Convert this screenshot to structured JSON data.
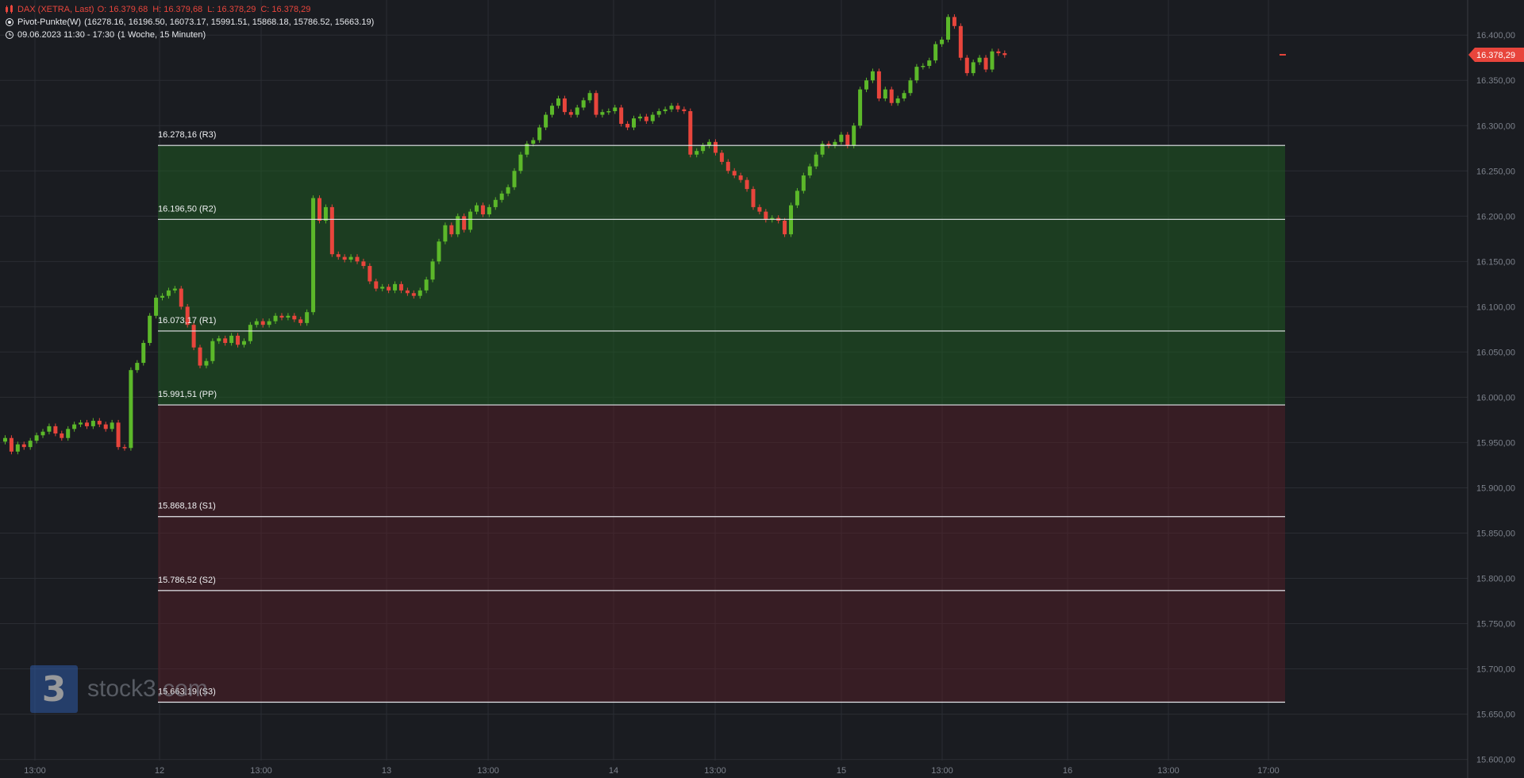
{
  "header": {
    "title": "DAX (XETRA, Last)",
    "ohlc": [
      "O: 16.379,68",
      "H: 16.379,68",
      "L: 16.378,29",
      "C: 16.378,29"
    ],
    "indicator": "Pivot-Punkte(W)",
    "indicator_values": "(16278.16,  16196.50,  16073.17,  15991.51,  15868.18,  15786.52,  15663.19)",
    "timestamp": "09.06.2023 11:30 - 17:30",
    "period": "(1 Woche, 15 Minuten)"
  },
  "colors": {
    "up": "#5cb82a",
    "down": "#e8453c",
    "background": "#1a1c21",
    "grid": "#2a2d33",
    "resistance_zone": "#1c3a1e",
    "support_zone": "#3a1c21"
  },
  "logo": {
    "text": "stock3.com"
  },
  "chart_data": {
    "type": "candlestick",
    "y_axis": {
      "side": "right",
      "range": [
        15590,
        16430
      ],
      "ticks": [
        16400,
        16350,
        16300,
        16250,
        16200,
        16150,
        16100,
        16050,
        16000,
        15950,
        15900,
        15850,
        15800,
        15750,
        15700,
        15650,
        15600
      ],
      "tick_labels": [
        "16.400,00",
        "16.350,00",
        "16.300,00",
        "16.250,00",
        "16.200,00",
        "16.150,00",
        "16.100,00",
        "16.050,00",
        "16.000,00",
        "15.950,00",
        "15.900,00",
        "15.850,00",
        "15.800,00",
        "15.750,00",
        "15.700,00",
        "15.650,00",
        "15.600,00"
      ]
    },
    "x_axis": {
      "tick_labels": [
        "13:00",
        "12",
        "13:00",
        "13",
        "13:00",
        "14",
        "13:00",
        "15",
        "13:00",
        "16",
        "13:00",
        "17:00"
      ]
    },
    "last_price": {
      "value": 16378.29,
      "label": "16.378,29"
    },
    "pivot_levels": [
      {
        "value": 16278.16,
        "label": "16.278,16 (R3)"
      },
      {
        "value": 16196.5,
        "label": "16.196,50 (R2)"
      },
      {
        "value": 16073.17,
        "label": "16.073,17 (R1)"
      },
      {
        "value": 15991.51,
        "label": "15.991,51 (PP)"
      },
      {
        "value": 15868.18,
        "label": "15.868,18 (S1)"
      },
      {
        "value": 15786.52,
        "label": "15.786,52 (S2)"
      },
      {
        "value": 15663.19,
        "label": "15.663,19 (S3)"
      }
    ],
    "grid": true,
    "closes": [
      15955,
      15940,
      15948,
      15945,
      15952,
      15958,
      15962,
      15968,
      15960,
      15955,
      15965,
      15970,
      15972,
      15968,
      15974,
      15970,
      15965,
      15972,
      15945,
      15944,
      16030,
      16038,
      16060,
      16090,
      16110,
      16112,
      16118,
      16120,
      16100,
      16080,
      16055,
      16035,
      16040,
      16062,
      16065,
      16060,
      16068,
      16058,
      16062,
      16080,
      16084,
      16080,
      16084,
      16090,
      16088,
      16090,
      16086,
      16082,
      16094,
      16220,
      16195,
      16210,
      16158,
      16155,
      16152,
      16155,
      16150,
      16145,
      16128,
      16120,
      16122,
      16118,
      16125,
      16118,
      16115,
      16112,
      16118,
      16130,
      16150,
      16172,
      16190,
      16180,
      16200,
      16185,
      16205,
      16212,
      16202,
      16210,
      16218,
      16225,
      16232,
      16250,
      16268,
      16280,
      16284,
      16298,
      16312,
      16322,
      16330,
      16315,
      16312,
      16320,
      16328,
      16336,
      16312,
      16315,
      16316,
      16320,
      16302,
      16298,
      16308,
      16310,
      16305,
      16312,
      16316,
      16318,
      16322,
      16318,
      16316,
      16268,
      16272,
      16278,
      16282,
      16270,
      16260,
      16250,
      16245,
      16240,
      16230,
      16210,
      16205,
      16196,
      16198,
      16195,
      16180,
      16212,
      16228,
      16245,
      16255,
      16268,
      16280,
      16278,
      16282,
      16290,
      16278,
      16300,
      16340,
      16350,
      16360,
      16330,
      16340,
      16325,
      16330,
      16336,
      16350,
      16365,
      16366,
      16372,
      16390,
      16395,
      16420,
      16410,
      16375,
      16358,
      16370,
      16375,
      16362,
      16382,
      16380,
      16378
    ]
  }
}
